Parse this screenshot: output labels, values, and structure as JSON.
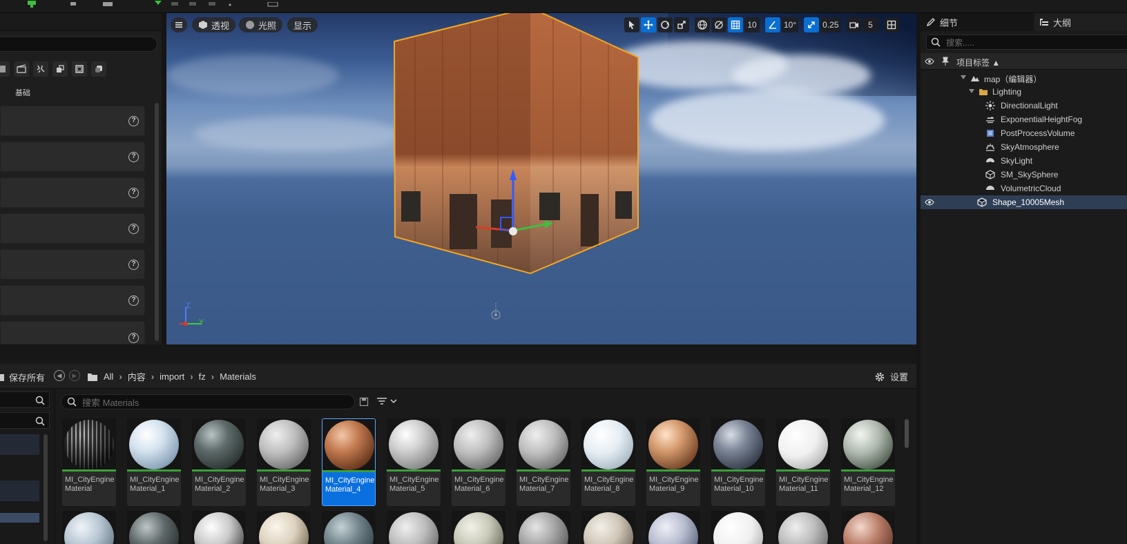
{
  "viewport": {
    "perspective_label": "透视",
    "lighting_label": "光照",
    "show_label": "显示",
    "grid_snap": "10",
    "rotate_snap": "10°",
    "scale_snap": "0.25",
    "camera_speed": "5",
    "axis_y": "Y",
    "axis_z": "Z"
  },
  "left_panel": {
    "category_label": "基础",
    "help_glyph": "?"
  },
  "right_panel": {
    "tab_details": "细节",
    "tab_outliner": "大纲",
    "search_placeholder": "搜索.....",
    "column_label": "项目标签",
    "tree": [
      {
        "label": "map（编辑器）"
      },
      {
        "label": "Lighting"
      },
      {
        "label": "DirectionalLight"
      },
      {
        "label": "ExponentialHeightFog"
      },
      {
        "label": "PostProcessVolume"
      },
      {
        "label": "SkyAtmosphere"
      },
      {
        "label": "SkyLight"
      },
      {
        "label": "SM_SkySphere"
      },
      {
        "label": "VolumetricCloud"
      },
      {
        "label": "Shape_10005Mesh"
      }
    ]
  },
  "content_browser": {
    "save_all": "保存所有",
    "breadcrumb": [
      "All",
      "内容",
      "import",
      "fz",
      "Materials"
    ],
    "settings": "设置",
    "search_placeholder": "搜索 Materials",
    "assets": [
      {
        "name": "MI_CityEngineMaterial",
        "selected": false
      },
      {
        "name": "MI_CityEngineMaterial_1",
        "selected": false
      },
      {
        "name": "MI_CityEngineMaterial_2",
        "selected": false
      },
      {
        "name": "MI_CityEngineMaterial_3",
        "selected": false
      },
      {
        "name": "MI_CityEngineMaterial_4",
        "selected": true
      },
      {
        "name": "MI_CityEngineMaterial_5",
        "selected": false
      },
      {
        "name": "MI_CityEngineMaterial_6",
        "selected": false
      },
      {
        "name": "MI_CityEngineMaterial_7",
        "selected": false
      },
      {
        "name": "MI_CityEngineMaterial_8",
        "selected": false
      },
      {
        "name": "MI_CityEngineMaterial_9",
        "selected": false
      },
      {
        "name": "MI_CityEngineMaterial_10",
        "selected": false
      },
      {
        "name": "MI_CityEngineMaterial_11",
        "selected": false
      },
      {
        "name": "MI_CityEngineMaterial_12",
        "selected": false
      }
    ]
  },
  "colors": {
    "accent": "#0a70e0",
    "selection_outline": "#f5a623",
    "tree_selected": "#2e3e55"
  }
}
